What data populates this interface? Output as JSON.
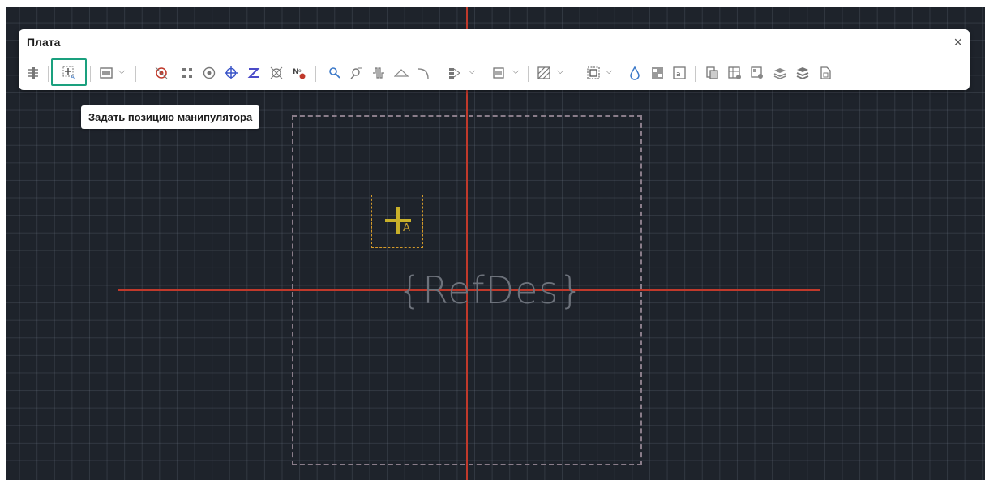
{
  "panel": {
    "title": "Плата",
    "close_glyph": "×",
    "tools": [
      {
        "name": "component-pins-icon"
      },
      {
        "name": "set-manipulator-position-icon",
        "active": true
      },
      {
        "name": "board-frame-icon",
        "dropdown": true
      },
      {
        "name": "target-point-icon"
      },
      {
        "name": "grid-pads-icon"
      },
      {
        "name": "via-icon"
      },
      {
        "name": "crosshair-icon"
      },
      {
        "name": "route-icon"
      },
      {
        "name": "autoplace-icon"
      },
      {
        "name": "numbering-icon"
      },
      {
        "name": "zoom-search-icon"
      },
      {
        "name": "measure-icon"
      },
      {
        "name": "trace-tune-icon"
      },
      {
        "name": "arc-triangle-icon"
      },
      {
        "name": "arc-icon"
      },
      {
        "name": "layer-stack-icon",
        "dropdown": true
      },
      {
        "name": "footprint-icon",
        "dropdown": true
      },
      {
        "name": "hatch-fill-icon",
        "dropdown": true
      },
      {
        "name": "keepout-area-icon",
        "dropdown": true
      },
      {
        "name": "drop-icon"
      },
      {
        "name": "qr-icon"
      },
      {
        "name": "text-frame-icon"
      },
      {
        "name": "copy-layers-icon"
      },
      {
        "name": "table-icon"
      },
      {
        "name": "components-add-icon"
      },
      {
        "name": "layers-icon"
      },
      {
        "name": "layers-alt-icon"
      },
      {
        "name": "document-icon"
      }
    ]
  },
  "tooltip": {
    "text": "Задать позицию манипулятора"
  },
  "canvas": {
    "refdes_label": "{RefDes}",
    "origin_letter": "A",
    "colors": {
      "background": "#1e232b",
      "axis": "#c0392b",
      "board_outline": "#8a7d8a",
      "origin_marker": "#c8b02a",
      "accent_active": "#1aa07e"
    }
  }
}
